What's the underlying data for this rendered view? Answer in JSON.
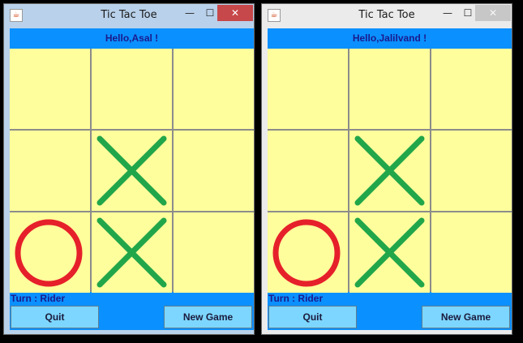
{
  "windows": [
    {
      "title": "Tic Tac Toe",
      "active": true,
      "greeting": "Hello,Asal !",
      "turn": "Turn : Rider",
      "buttons": {
        "quit": "Quit",
        "new_game": "New Game"
      },
      "board": [
        "",
        "",
        "",
        "",
        "X",
        "",
        "O",
        "X",
        ""
      ]
    },
    {
      "title": "Tic Tac Toe",
      "active": false,
      "greeting": "Hello,Jalilvand !",
      "turn": "Turn : Rider",
      "buttons": {
        "quit": "Quit",
        "new_game": "New Game"
      },
      "board": [
        "",
        "",
        "",
        "",
        "X",
        "",
        "O",
        "X",
        ""
      ]
    }
  ],
  "window_controls": {
    "minimize": "—",
    "maximize": "☐",
    "close": "✕"
  },
  "app_icon": "java-icon",
  "colors": {
    "client_bg": "#0b90ff",
    "cell_bg": "#fffe9c",
    "x_mark": "#22a64a",
    "o_mark": "#e6202a",
    "button_bg": "#7dd6ff",
    "text": "#1a1a8c",
    "close_active": "#c7484a"
  }
}
